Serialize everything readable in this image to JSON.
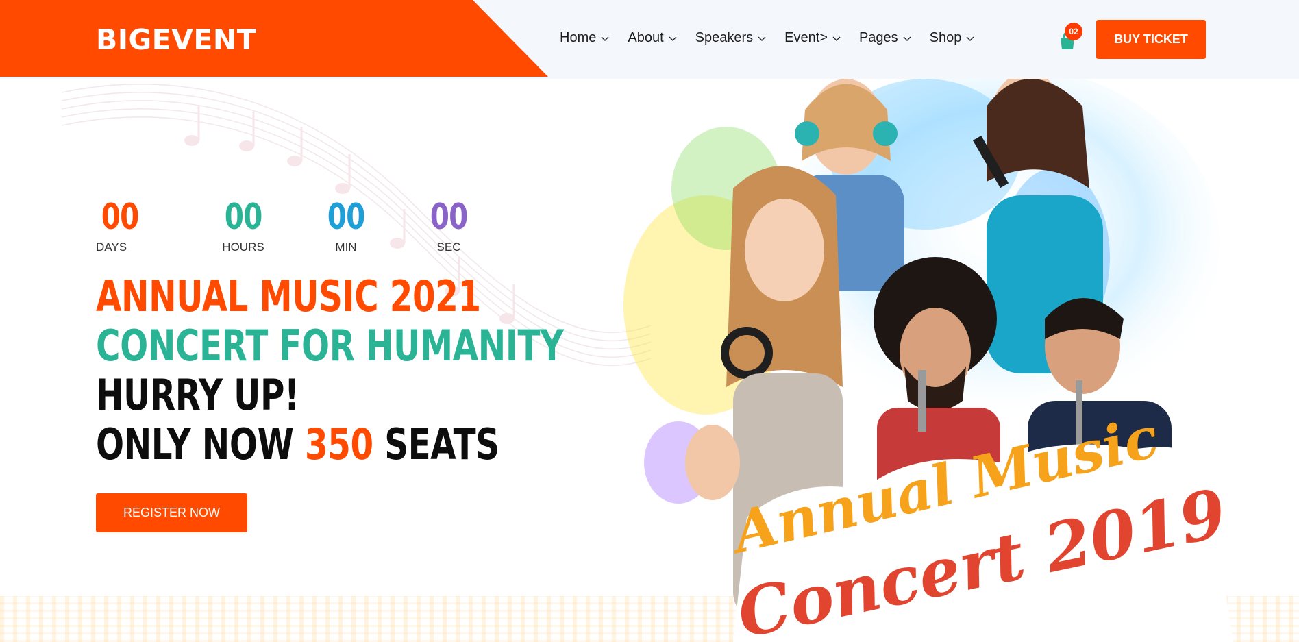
{
  "header": {
    "logo": "BIGEVENT",
    "nav": [
      {
        "label": "Home",
        "name": "nav-home"
      },
      {
        "label": "About",
        "name": "nav-about"
      },
      {
        "label": "Speakers",
        "name": "nav-speakers"
      },
      {
        "label": "Event>",
        "name": "nav-event"
      },
      {
        "label": "Pages",
        "name": "nav-pages"
      },
      {
        "label": "Shop",
        "name": "nav-shop"
      }
    ],
    "cart_count": "02",
    "buy_ticket_label": "BUY TICKET"
  },
  "countdown": [
    {
      "value": "00",
      "label": "DAYS",
      "color": "#ff4a00"
    },
    {
      "value": "00",
      "label": "HOURS",
      "color": "#2ab395"
    },
    {
      "value": "00",
      "label": "MIN",
      "color": "#1f9fd8"
    },
    {
      "value": "00",
      "label": "SEC",
      "color": "#8a63c9"
    }
  ],
  "headline": {
    "line1": "ANNUAL MUSIC 2021",
    "line2": "CONCERT FOR HUMANITY",
    "line3": "HURRY UP!",
    "line4_prefix": "ONLY NOW",
    "line4_number": "350",
    "line4_suffix": "SEATS"
  },
  "register_label": "REGISTER NOW",
  "hero_banner": {
    "line1": "Annual Music",
    "line2": "Concert 2019"
  },
  "colors": {
    "brand": "#ff4a00",
    "teal": "#2ab395",
    "blue": "#1f9fd8",
    "purple": "#8a63c9"
  }
}
